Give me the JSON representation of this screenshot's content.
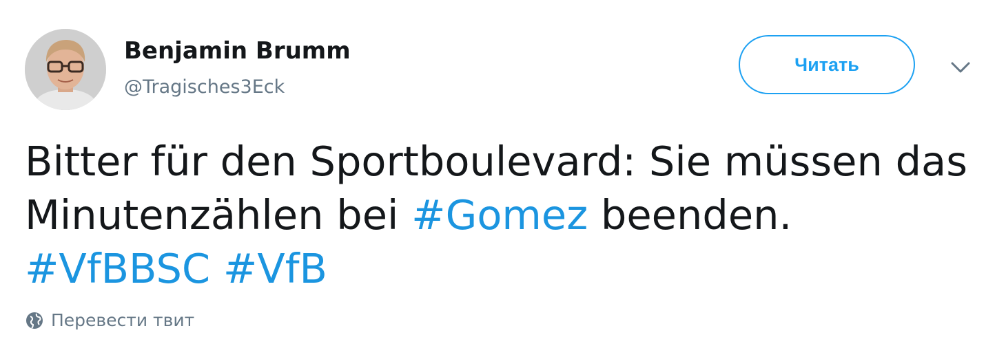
{
  "author": {
    "display_name": "Benjamin Brumm",
    "handle": "@Tragisches3Eck",
    "avatar_icon": "user-avatar"
  },
  "follow_button": {
    "label": "Читать"
  },
  "menu": {
    "icon": "chevron-down-icon"
  },
  "tweet": {
    "line1": "Bitter für den Sportboulevard: Sie müssen das",
    "line2_before": "Minutenzählen bei ",
    "hashtag_gomez": "#Gomez",
    "line2_after": " beenden.",
    "hashtag_vfbbsc": "#VfBBSC",
    "hashtag_vfb": "#VfB"
  },
  "translate": {
    "label": "Перевести твит",
    "icon": "globe-icon"
  },
  "colors": {
    "accent": "#1da1f2",
    "hashtag": "#1b95e0",
    "text": "#14171a",
    "muted": "#657786"
  }
}
